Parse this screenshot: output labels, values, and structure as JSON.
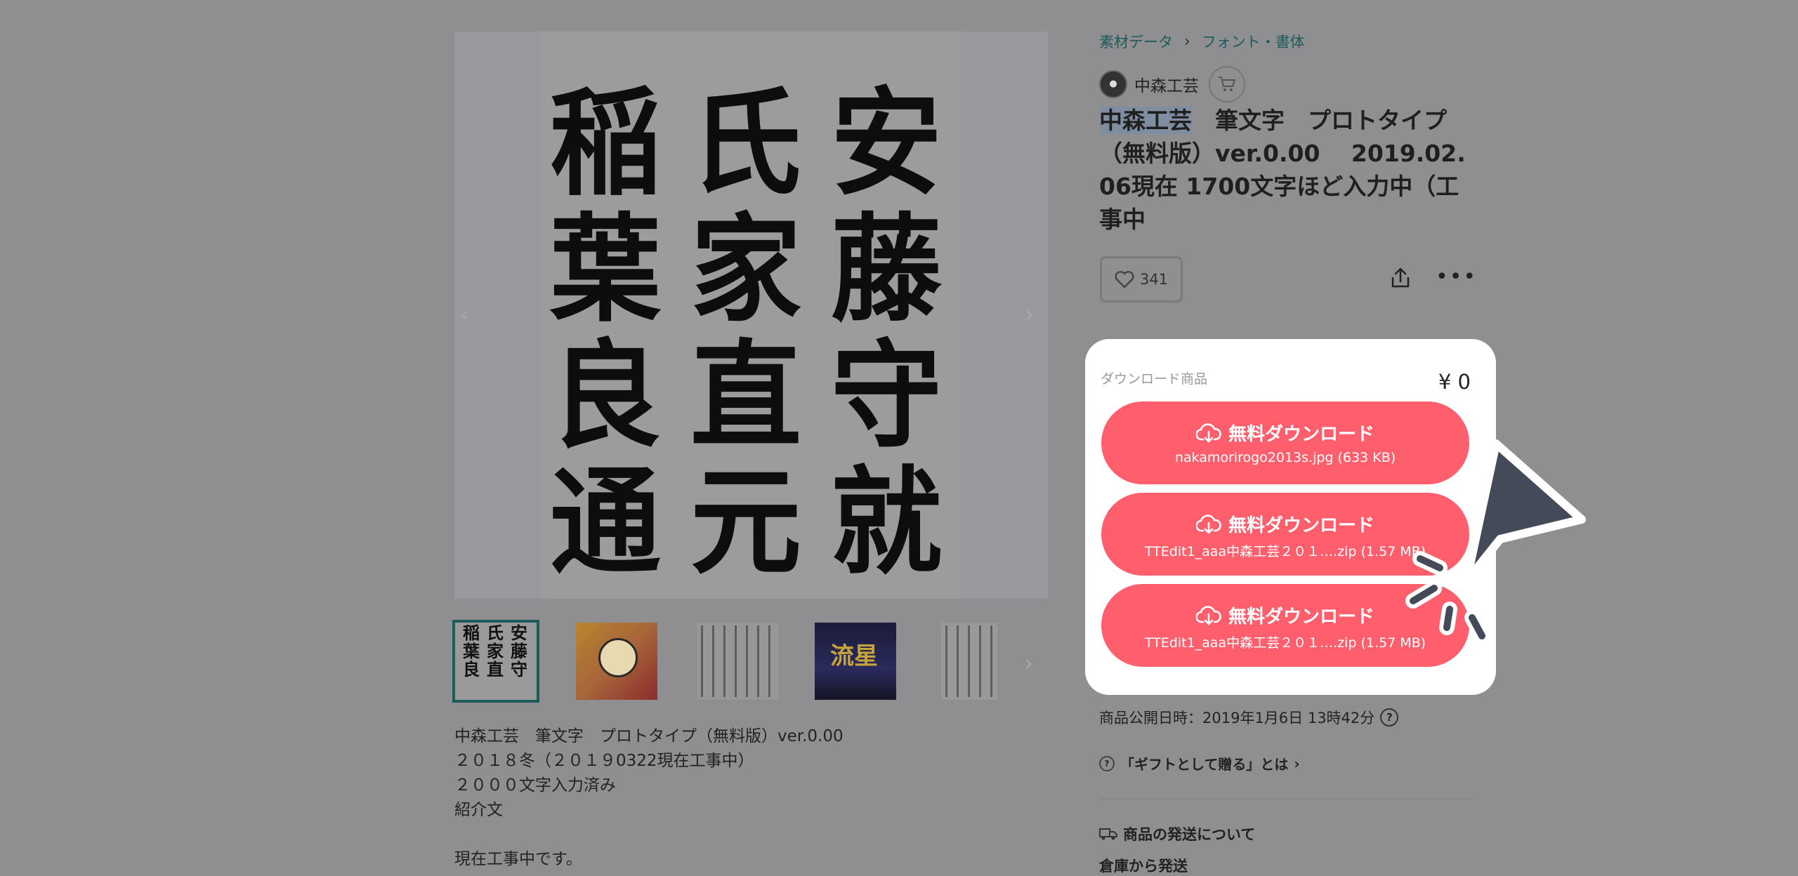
{
  "gallery": {
    "calligraphy_rows": [
      [
        "稲",
        "氏",
        "安"
      ],
      [
        "葉",
        "家",
        "藤"
      ],
      [
        "良",
        "直",
        "守"
      ],
      [
        "通",
        "元",
        "就"
      ]
    ],
    "thumb1_chars": [
      "氏",
      "安",
      "葉",
      "家",
      "藤",
      "良",
      "直",
      "守"
    ],
    "thumb4_title": "流星",
    "prev_arrow": "‹",
    "next_arrow": "›"
  },
  "description": {
    "line1": "中森工芸　筆文字　プロトタイプ（無料版）ver.0.00",
    "line2": "２０１８冬（２０１９0322現在工事中）",
    "line3": "２０００文字入力済み",
    "line4": "紹介文",
    "line5": "現在工事中です。"
  },
  "breadcrumb": {
    "item1": "素材データ",
    "separator": "›",
    "item2": "フォント・書体"
  },
  "shop": {
    "name": "中森工芸"
  },
  "product": {
    "title_highlight": "中森工芸",
    "title_rest": "　筆文字　プロトタイプ（無料版）ver.0.00　 2019.02.06現在 1700文字ほど入力中（工事中",
    "likes": "341"
  },
  "download_panel": {
    "label": "ダウンロード商品",
    "price": "¥ 0",
    "buttons": [
      {
        "label": "無料ダウンロード",
        "file": "nakamorirogo2013s.jpg (633 KB)"
      },
      {
        "label": "無料ダウンロード",
        "file": "TTEdit1_aaa中森工芸２０１….zip (1.57 MB)"
      },
      {
        "label": "無料ダウンロード",
        "file": "TTEdit1_aaa中森工芸２０１….zip (1.57 MB)"
      }
    ]
  },
  "meta": {
    "published": "商品公開日時：2019年1月6日 13時42分",
    "gift_link": "「ギフトとして贈る」とは",
    "shipping_head": "商品の発送について",
    "shipping_sub": "倉庫から発送"
  },
  "colors": {
    "accent": "#ff5f6d",
    "link": "#1d5a5b",
    "overlay": "#8f8f91"
  }
}
